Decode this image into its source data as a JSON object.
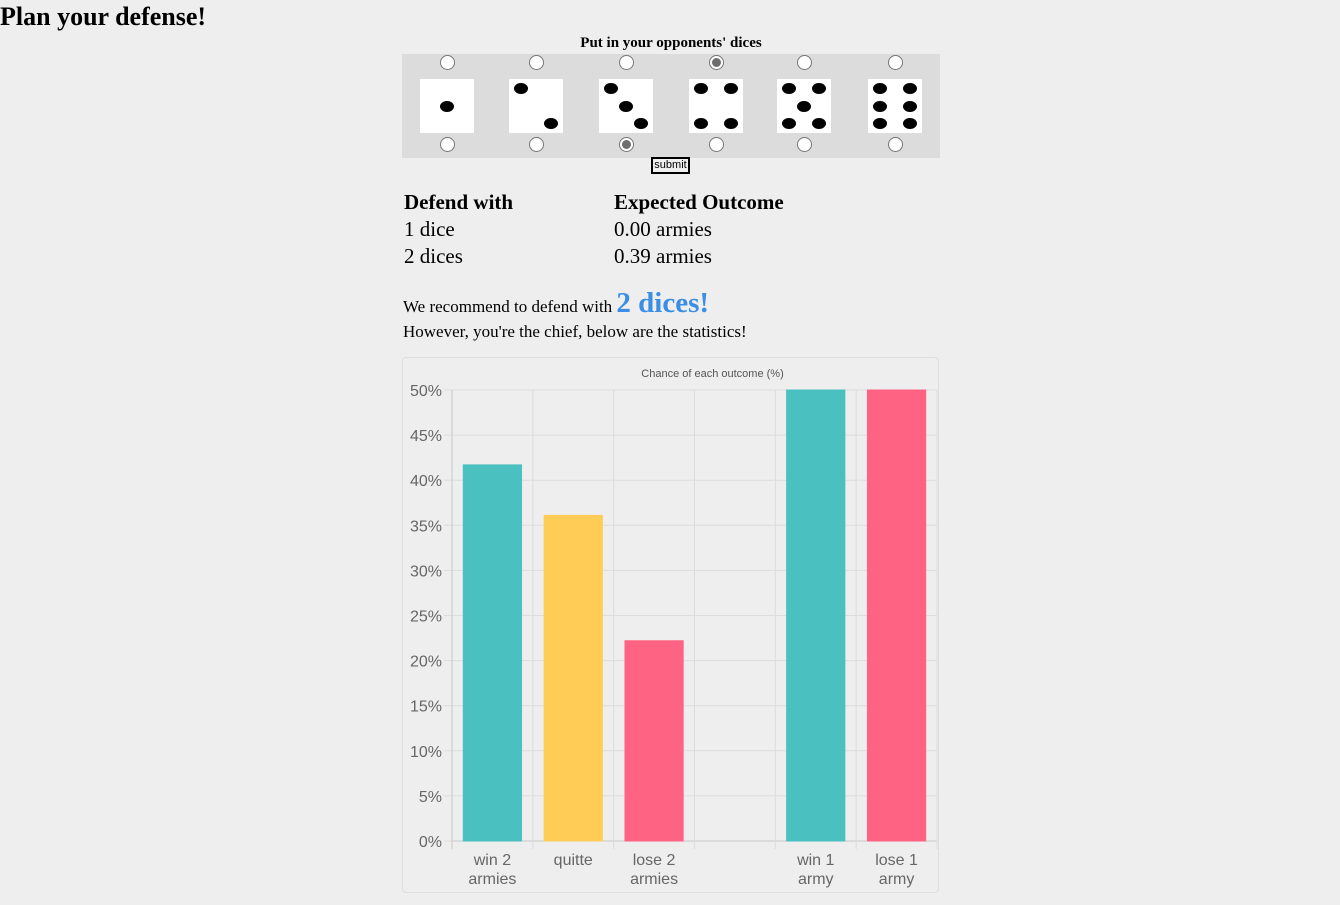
{
  "page": {
    "title": "Plan your defense!",
    "dice_caption": "Put in your opponents' dices",
    "submit_label": "submit",
    "top_selected": 4,
    "bottom_selected": 3,
    "die_faces": [
      1,
      2,
      3,
      4,
      5,
      6
    ]
  },
  "table": {
    "header_defend": "Defend with",
    "header_outcome": "Expected Outcome",
    "rows": [
      {
        "defend": "1 dice",
        "outcome": "0.00 armies"
      },
      {
        "defend": "2 dices",
        "outcome": "0.39 armies"
      }
    ]
  },
  "recommendation": {
    "prefix": "We recommend to defend with",
    "value": "2 dices!",
    "note": "However, you're the chief, below are the statistics!"
  },
  "colors": {
    "teal": "#4bc0c0",
    "yellow": "#ffcd56",
    "pink": "#ff6384",
    "recommend_blue": "#3a8ee6"
  },
  "chart_data": {
    "type": "bar",
    "title": "Chance of each outcome (%)",
    "categories": [
      [
        "win 2",
        "armies"
      ],
      [
        "quitte"
      ],
      [
        "lose 2",
        "armies"
      ],
      [
        ""
      ],
      [
        "win 1",
        "army"
      ],
      [
        "lose 1",
        "army"
      ]
    ],
    "values": [
      41.7,
      36.1,
      22.2,
      null,
      50,
      50
    ],
    "bar_colors": [
      "#4bc0c0",
      "#ffcd56",
      "#ff6384",
      null,
      "#4bc0c0",
      "#ff6384"
    ],
    "ylim": [
      0,
      50
    ],
    "yticks": [
      "0%",
      "5%",
      "10%",
      "15%",
      "20%",
      "25%",
      "30%",
      "35%",
      "40%",
      "45%",
      "50%"
    ],
    "grid": true
  }
}
